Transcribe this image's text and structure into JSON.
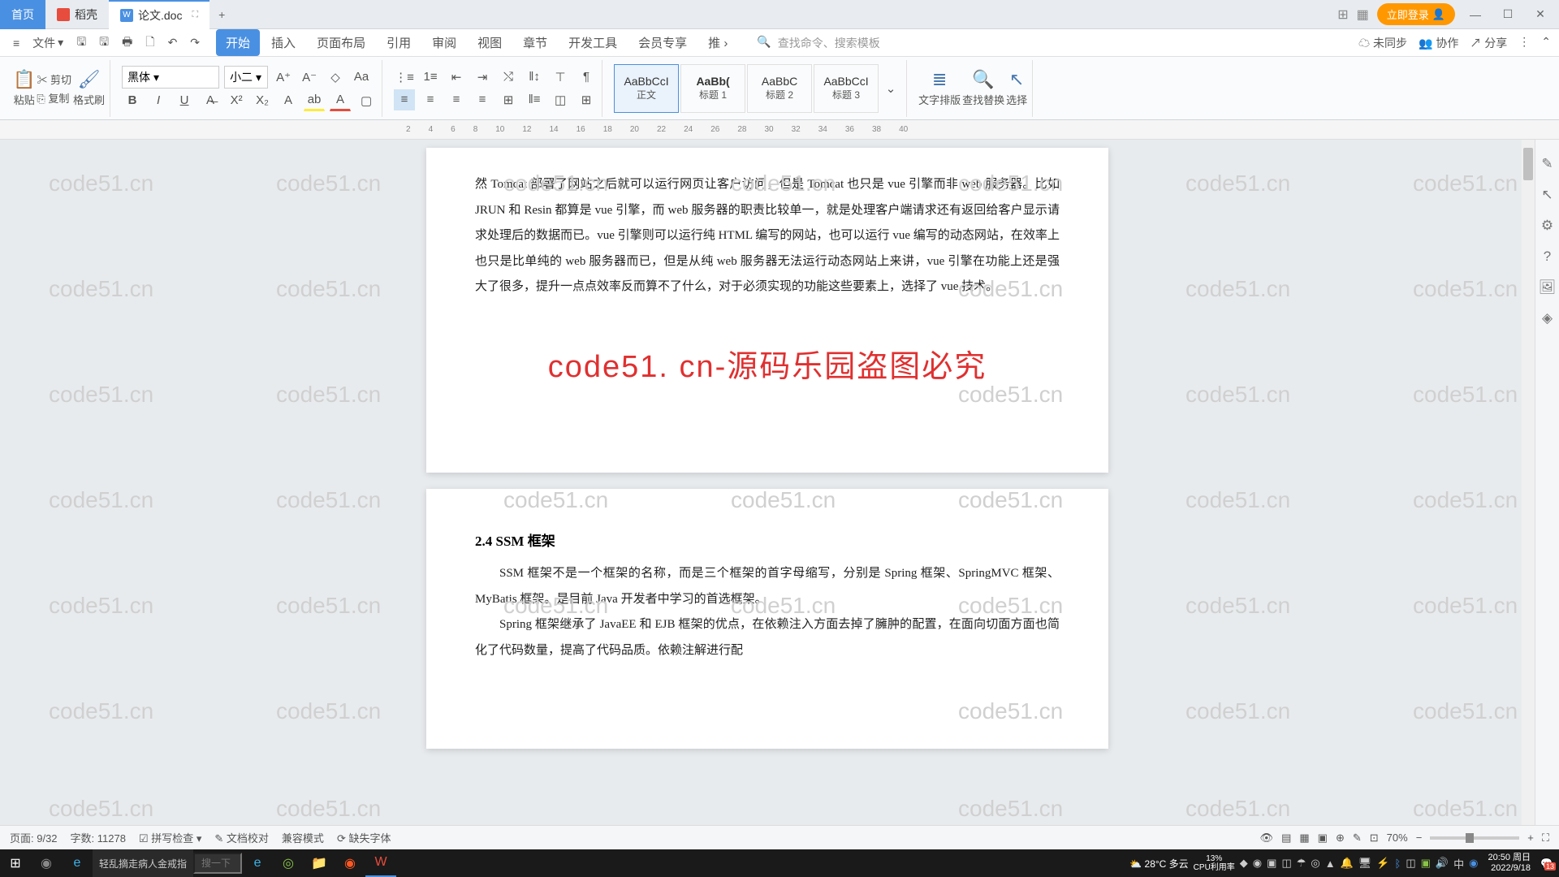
{
  "tabs": {
    "home": "首页",
    "dk": "稻壳",
    "doc": "论文.doc"
  },
  "login": "立即登录",
  "file_menu": "文件",
  "menus": [
    "开始",
    "插入",
    "页面布局",
    "引用",
    "审阅",
    "视图",
    "章节",
    "开发工具",
    "会员专享",
    "推"
  ],
  "search_cmd": "查找命令、搜索模板",
  "sync": "未同步",
  "collab": "协作",
  "share": "分享",
  "clipboard": {
    "paste": "粘贴",
    "cut": "剪切",
    "copy": "复制",
    "brush": "格式刷"
  },
  "font": {
    "name": "黑体",
    "size": "小二"
  },
  "styles": {
    "prev": "AaBbCcI",
    "normal": "正文",
    "h1": "标题 1",
    "h2": "标题 2",
    "h3": "标题 3"
  },
  "right_tools": {
    "layout": "文字排版",
    "find": "查找替换",
    "select": "选择"
  },
  "ruler_marks": [
    "2",
    "4",
    "6",
    "8",
    "10",
    "12",
    "14",
    "16",
    "18",
    "20",
    "22",
    "24",
    "26",
    "28",
    "30",
    "32",
    "34",
    "36",
    "38",
    "40"
  ],
  "para1": "然 Tomcat 部署了网站之后就可以运行网页让客户访问，但是 Tomcat 也只是 vue 引擎而非 web 服务器。比如 JRUN 和 Resin 都算是 vue 引擎，而 web 服务器的职责比较单一，就是处理客户端请求还有返回给客户显示请求处理后的数据而已。vue 引擎则可以运行纯 HTML 编写的网站，也可以运行 vue 编写的动态网站，在效率上也只是比单纯的 web 服务器而已，但是从纯 web 服务器无法运行动态网站上来讲，vue 引擎在功能上还是强大了很多，提升一点点效率反而算不了什么，对于必须实现的功能这些要素上，选择了 vue 技术。",
  "wm_center": "code51. cn-源码乐园盗图必究",
  "heading24": "2.4 SSM 框架",
  "para2": "SSM 框架不是一个框架的名称，而是三个框架的首字母缩写，分别是 Spring 框架、SpringMVC 框架、MyBatis 框架。是目前 Java 开发者中学习的首选框架。",
  "para3": "Spring 框架继承了 JavaEE 和 EJB 框架的优点，在依赖注入方面去掉了臃肿的配置，在面向切面方面也简化了代码数量，提高了代码品质。依赖注解进行配",
  "wm_text": "code51.cn",
  "status": {
    "page": "页面: 9/32",
    "words": "字数: 11278",
    "spell": "拼写检查",
    "proof": "文档校对",
    "compat": "兼容模式",
    "missing": "缺失字体",
    "zoom": "70%"
  },
  "task": {
    "search": "搜一下",
    "ie_text": "轻乱摘走病人金戒指",
    "weather": "28°C 多云",
    "cpu": "CPU利用率",
    "pct": "13%",
    "time": "20:50 周日",
    "date": "2022/9/18",
    "badge": "13"
  }
}
